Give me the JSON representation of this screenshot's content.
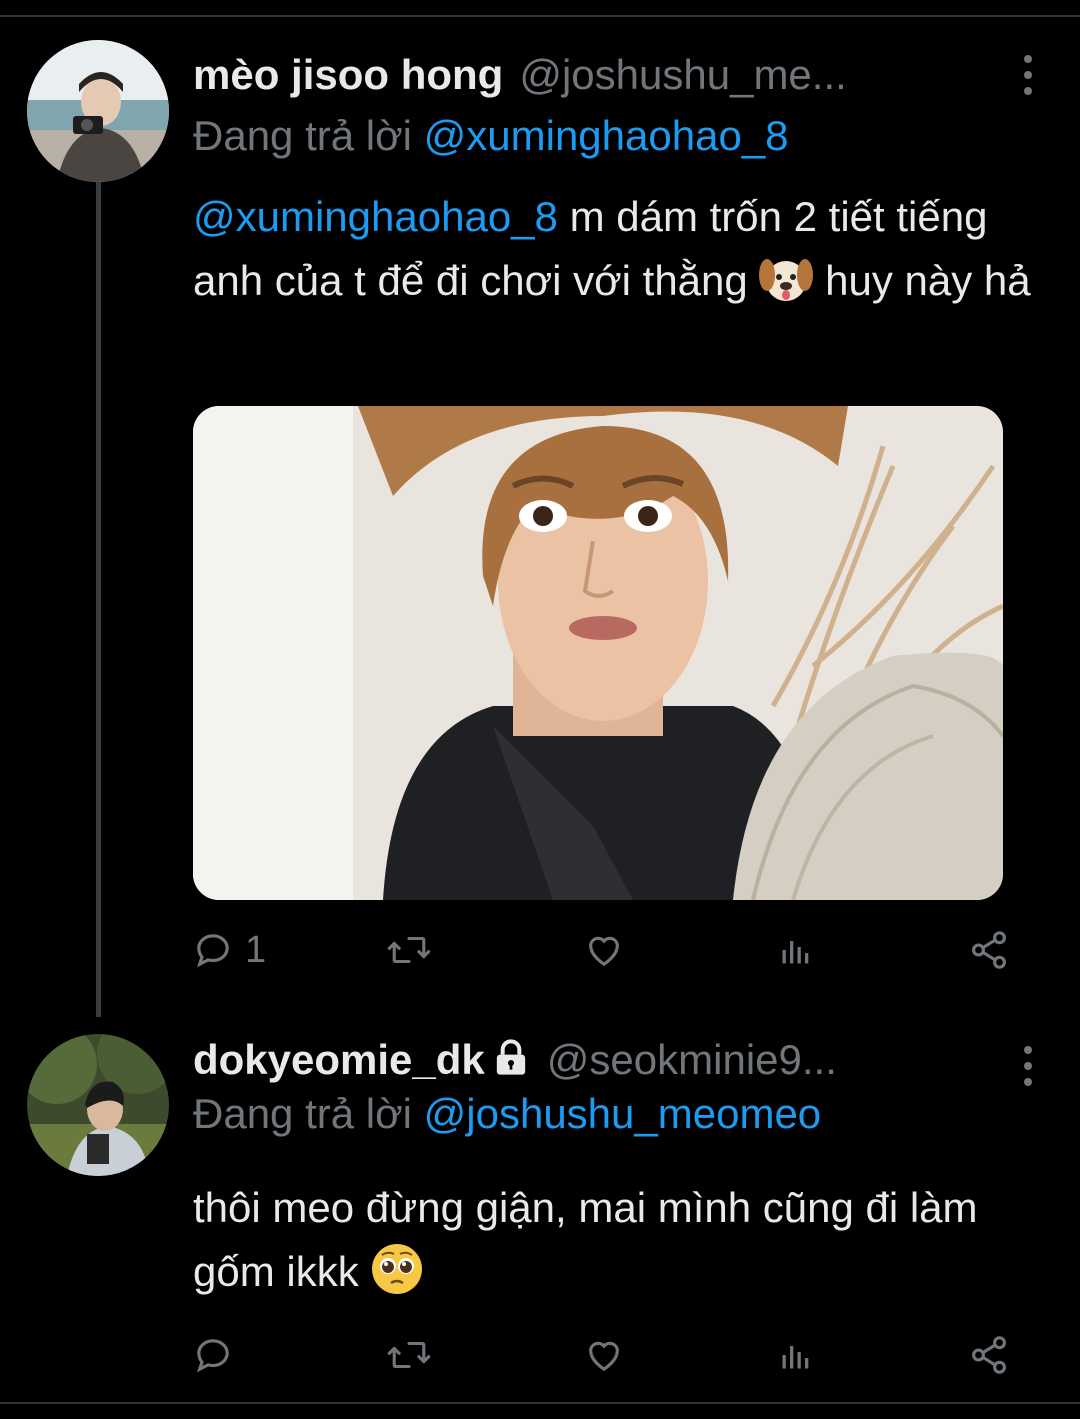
{
  "colors": {
    "background": "#000000",
    "text": "#e7e9ea",
    "muted": "#71767b",
    "link": "#1d9bf0"
  },
  "tweets": [
    {
      "display_name": "mèo jisoo hong",
      "handle": "@joshushu_me...",
      "protected": false,
      "replying_prefix": "Đang trả lời ",
      "replying_to": "@xuminghaohao_8",
      "text_mention": "@xuminghaohao_8",
      "text_part1": " m dám trốn 2 tiết tiếng anh của t để đi chơi với thằng ",
      "emoji": "dog-face-emoji",
      "text_part2": " huy này hả",
      "has_media": true,
      "actions": {
        "reply_count": "1",
        "retweet_count": "",
        "like_count": ""
      }
    },
    {
      "display_name": "dokyeomie_dk",
      "handle": "@seokminie9...",
      "protected": true,
      "replying_prefix": "Đang trả lời ",
      "replying_to": "@joshushu_meomeo",
      "text_part1": "thôi meo đừng giận, mai mình cũng đi làm gốm ikkk ",
      "emoji": "pleading-face-emoji",
      "actions": {
        "reply_count": "",
        "retweet_count": "",
        "like_count": ""
      }
    }
  ],
  "icons": [
    "more-vert-icon",
    "reply-icon",
    "retweet-icon",
    "like-icon",
    "analytics-icon",
    "share-icon",
    "lock-icon"
  ]
}
